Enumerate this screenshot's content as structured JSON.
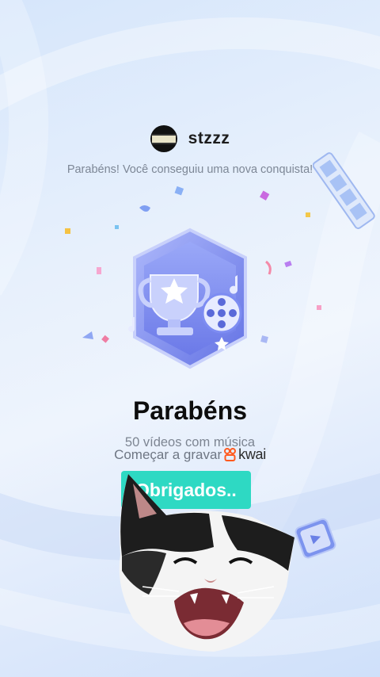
{
  "header": {
    "username": "stzzz",
    "achievement_message": "Parabéns! Você conseguiu uma nova conquista!"
  },
  "badge": {
    "icons": [
      "trophy-icon",
      "film-reel-icon",
      "star-icon"
    ]
  },
  "content": {
    "title": "Parabéns",
    "description": "50 vídeos com música",
    "cta_text": "Começar a gravar",
    "brand_name": "kwai"
  },
  "actions": {
    "thanks_label": "Obrigados.."
  },
  "colors": {
    "button": "#2ed9c3",
    "badge_primary": "#7d8cf2",
    "brand_orange": "#ff5a1f"
  }
}
